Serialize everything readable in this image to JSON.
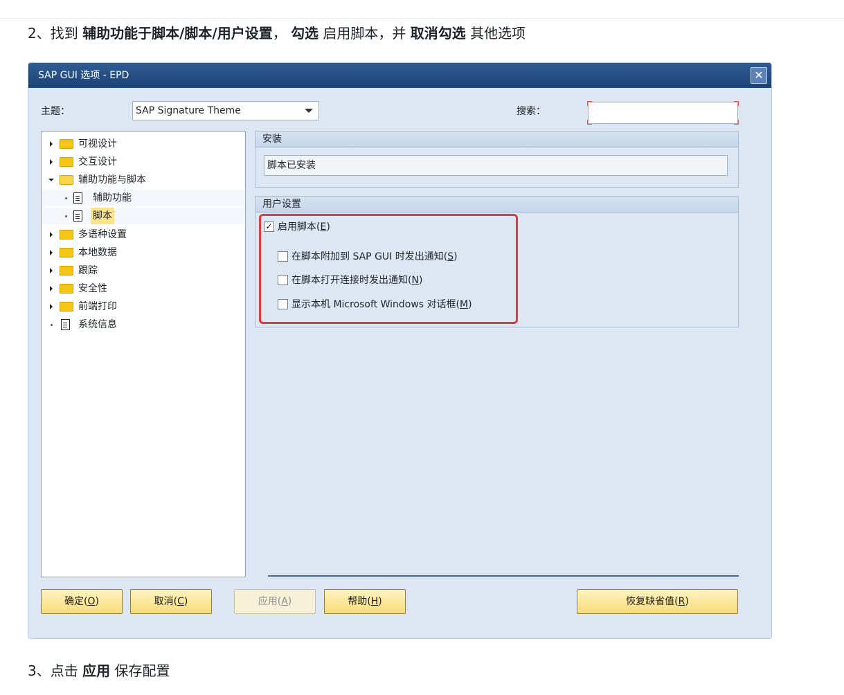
{
  "doc": {
    "step2": {
      "number": "2、",
      "t1": "找到 ",
      "b1": "辅助功能于脚本/脚本/用户设置",
      "t2": "， ",
      "b2": "勾选",
      "t3": " 启用脚本，并 ",
      "b3": "取消勾选",
      "t4": " 其他选项"
    },
    "step3": {
      "number": "3、",
      "t1": "点击 ",
      "b1": "应用",
      "t2": " 保存配置"
    }
  },
  "dialog": {
    "title": "SAP GUI 选项 - EPD",
    "close_icon": "close-icon",
    "theme_label": "主题：",
    "theme_value": "SAP Signature Theme",
    "search_label": "搜索：",
    "search_value": ""
  },
  "tree": {
    "items": [
      {
        "label": "可视设计",
        "icon": "folder-icon"
      },
      {
        "label": "交互设计",
        "icon": "folder-icon"
      },
      {
        "label": "辅助功能与脚本",
        "icon": "folder-open-icon"
      },
      {
        "label": "辅助功能",
        "icon": "document-icon"
      },
      {
        "label": "脚本",
        "icon": "document-icon",
        "selected": true
      },
      {
        "label": "多语种设置",
        "icon": "folder-icon"
      },
      {
        "label": "本地数据",
        "icon": "folder-icon"
      },
      {
        "label": "跟踪",
        "icon": "folder-icon"
      },
      {
        "label": "安全性",
        "icon": "folder-icon"
      },
      {
        "label": "前端打印",
        "icon": "folder-icon"
      },
      {
        "label": "系统信息",
        "icon": "document-icon"
      }
    ]
  },
  "install": {
    "header": "安装",
    "status": "脚本已安装"
  },
  "user_settings": {
    "header": "用户设置",
    "options": [
      {
        "label": "启用脚本(",
        "key": "E",
        "end": ")",
        "checked": true
      },
      {
        "label": "在脚本附加到 SAP GUI 时发出通知(",
        "key": "S",
        "end": ")",
        "checked": false
      },
      {
        "label": "在脚本打开连接时发出通知(",
        "key": "N",
        "end": ")",
        "checked": false
      },
      {
        "label": "显示本机 Microsoft Windows 对话框(",
        "key": "M",
        "end": ")",
        "checked": false
      }
    ]
  },
  "buttons": {
    "ok": {
      "label": "确定(",
      "key": "O",
      "end": ")"
    },
    "cancel": {
      "label": "取消(",
      "key": "C",
      "end": ")"
    },
    "apply": {
      "label": "应用(",
      "key": "A",
      "end": ")",
      "disabled": true
    },
    "help": {
      "label": "帮助(",
      "key": "H",
      "end": ")"
    },
    "restore": {
      "label": "恢复缺省值(",
      "key": "R",
      "end": ")"
    }
  },
  "colors": {
    "titlebar": "#1c4478",
    "dialog_bg": "#dce7f3",
    "highlight_box": "#e4393c",
    "button": "#f8dd7a",
    "selection": "#fde48a"
  }
}
